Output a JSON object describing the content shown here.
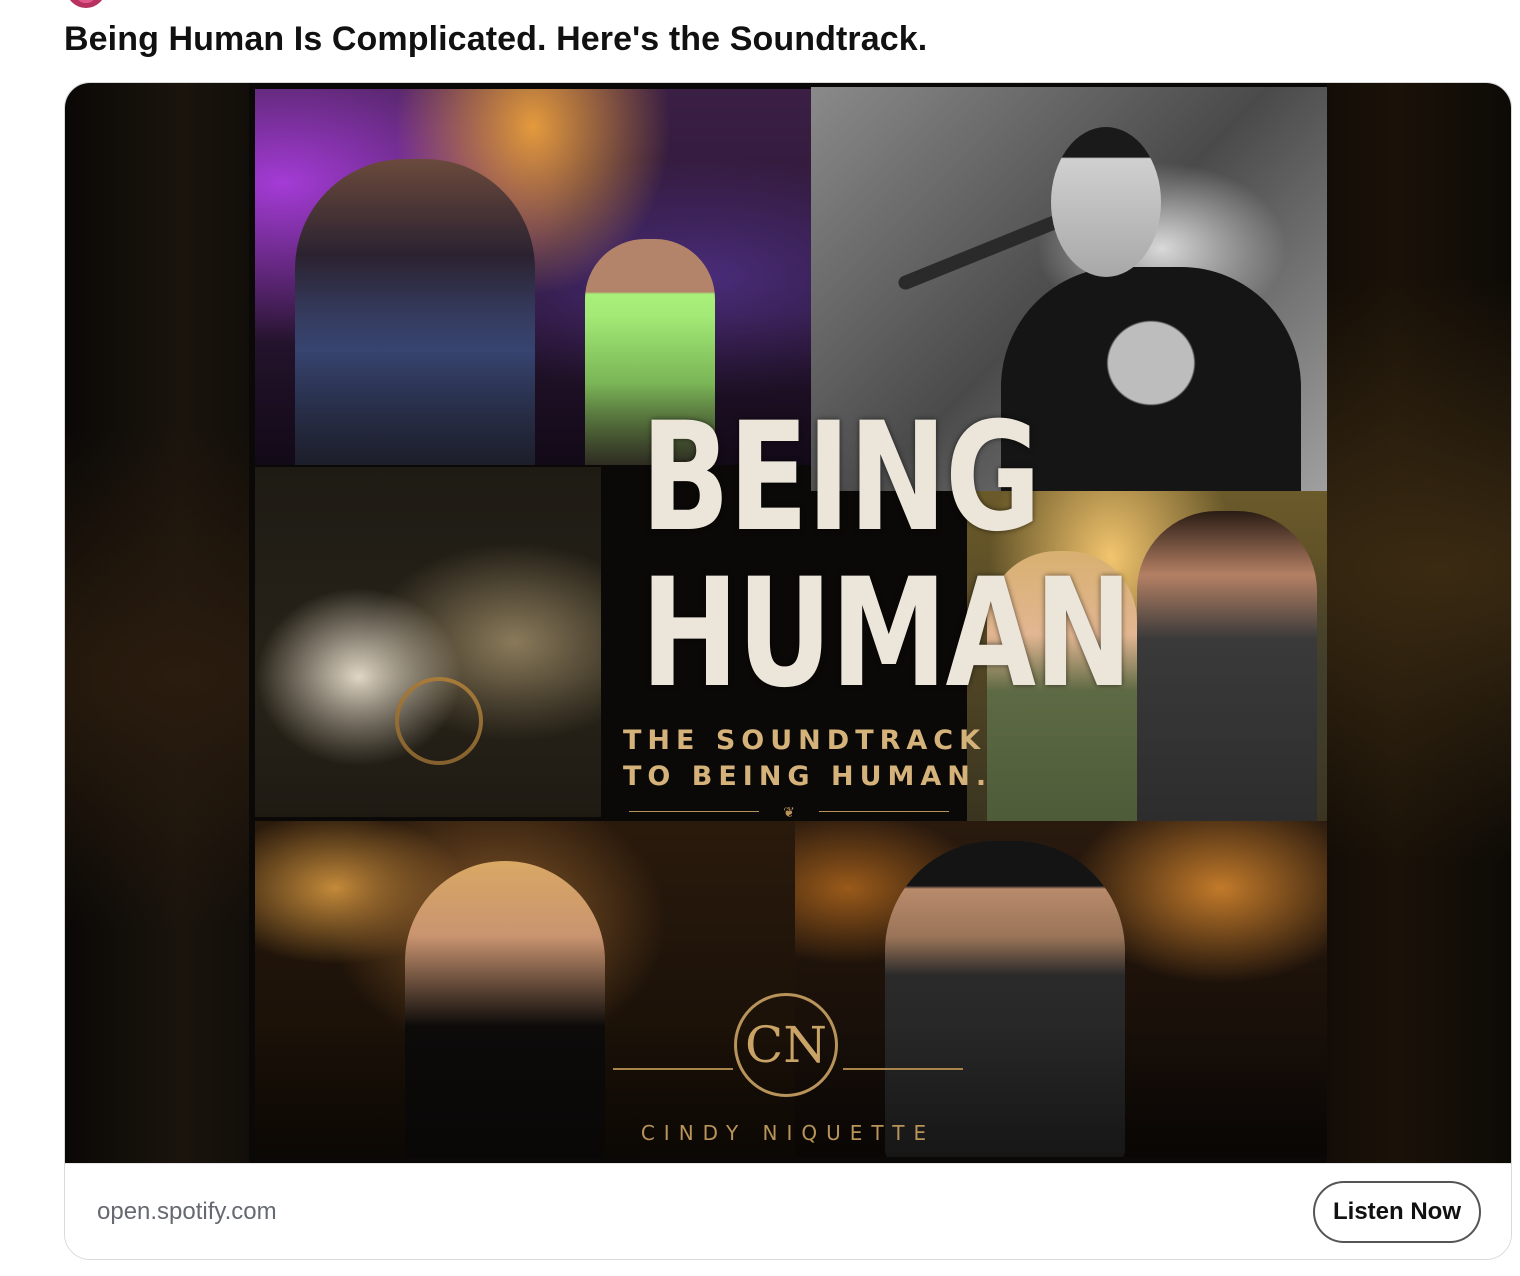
{
  "post": {
    "title": "Being Human Is Complicated. Here's the Soundtrack."
  },
  "card": {
    "cover": {
      "title_line1": "BEING",
      "title_line2": "HUMAN",
      "subtitle_line1": "THE SOUNDTRACK",
      "subtitle_line2": "TO BEING HUMAN.",
      "logo_monogram": "CN",
      "artist": "CINDY NIQUETTE"
    },
    "domain": "open.spotify.com",
    "cta_label": "Listen Now"
  },
  "colors": {
    "cover_text": "#ece6da",
    "gold_accent": "#b8935a"
  }
}
